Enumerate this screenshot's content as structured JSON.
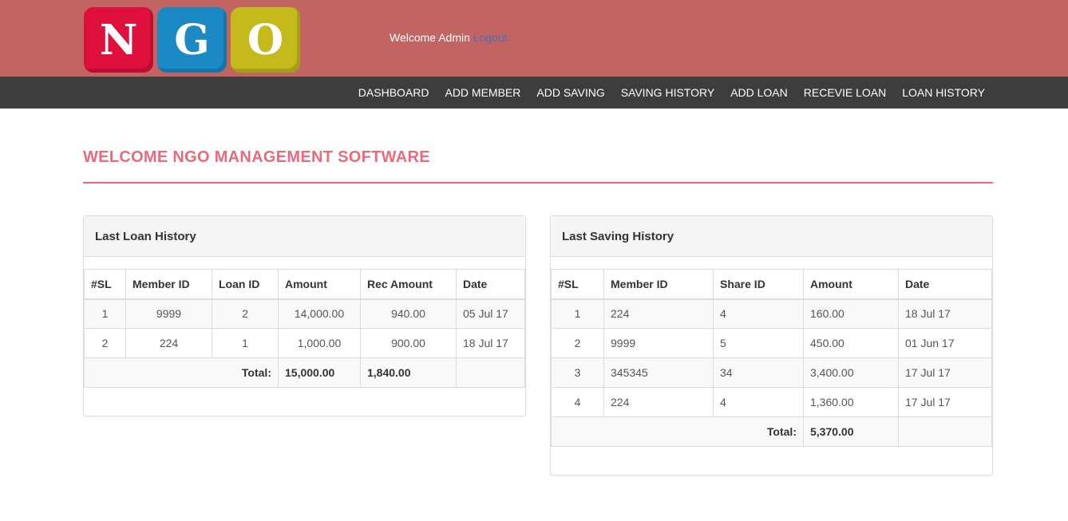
{
  "colors": {
    "header_bg": "#c26462",
    "navbar_bg": "#3d3d3d",
    "accent": "#e86a7c",
    "logo_n": "#e0103c",
    "logo_g": "#1b8ac4",
    "logo_o": "#c4ba1c",
    "logout_link": "#4a6fb5"
  },
  "logo": {
    "letters": [
      "N",
      "G",
      "O"
    ]
  },
  "header": {
    "welcome_text": "Welcome Admin",
    "logout_label": "Logout"
  },
  "nav": {
    "items": [
      "DASHBOARD",
      "ADD MEMBER",
      "ADD SAVING",
      "SAVING HISTORY",
      "ADD LOAN",
      "RECEVIE LOAN",
      "LOAN HISTORY"
    ]
  },
  "page": {
    "title": "WELCOME NGO MANAGEMENT SOFTWARE"
  },
  "loan_panel": {
    "title": "Last Loan History",
    "columns": [
      "#SL",
      "Member ID",
      "Loan ID",
      "Amount",
      "Rec Amount",
      "Date"
    ],
    "rows": [
      [
        "1",
        "9999",
        "2",
        "14,000.00",
        "940.00",
        "05 Jul 17"
      ],
      [
        "2",
        "224",
        "1",
        "1,000.00",
        "900.00",
        "18 Jul 17"
      ]
    ],
    "total_label": "Total:",
    "total_amount": "15,000.00",
    "total_rec_amount": "1,840.00"
  },
  "saving_panel": {
    "title": "Last Saving History",
    "columns": [
      "#SL",
      "Member ID",
      "Share ID",
      "Amount",
      "Date"
    ],
    "rows": [
      [
        "1",
        "224",
        "4",
        "160.00",
        "18 Jul 17"
      ],
      [
        "2",
        "9999",
        "5",
        "450.00",
        "01 Jun 17"
      ],
      [
        "3",
        "345345",
        "34",
        "3,400.00",
        "17 Jul 17"
      ],
      [
        "4",
        "224",
        "4",
        "1,360.00",
        "17 Jul 17"
      ]
    ],
    "total_label": "Total:",
    "total_amount": "5,370.00"
  }
}
